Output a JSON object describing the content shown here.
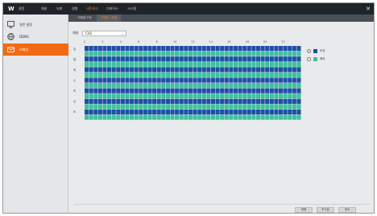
{
  "app": {
    "logo_text": "W",
    "close_glyph": "✕"
  },
  "top_menu": {
    "items": [
      "설정",
      "채널",
      "녹화",
      "경험",
      "네트워크",
      "디바이스",
      "시스템"
    ],
    "active_index": 4
  },
  "sidebar": {
    "items": [
      {
        "label": "일반 설정",
        "icon": "monitor-icon"
      },
      {
        "label": "DDNS",
        "icon": "globe-icon"
      },
      {
        "label": "이메일",
        "icon": "email-icon"
      }
    ],
    "active_index": 2
  },
  "tabs": {
    "items": [
      "이메일 구성",
      "이메일 스케줄"
    ],
    "active_index": 1
  },
  "channel": {
    "label": "채널",
    "value": "CH1",
    "chevron": "⌄"
  },
  "schedule": {
    "hours": [
      "0",
      "2",
      "4",
      "6",
      "8",
      "10",
      "12",
      "14",
      "16",
      "18",
      "20",
      "22"
    ],
    "days": [
      "일",
      "월",
      "화",
      "수",
      "목",
      "금",
      "토"
    ],
    "rows": [
      "bbbbbbbbbbbbbbbbbbbbbbbbbbbbbbbbbbbbbbbbbbbbbbbb",
      "tttttttttttttttttttttttttttttttttttttttttttttttt",
      "bbbbbbbbbbbbbbbbbbbbbbbbbbbbbbbbbbbbbbbbbbbbbbbb",
      "tttttttttttttttttttttttttttttttttttttttttttttttt",
      "bbbbbbbbbbbbbbbbbbbbbbbbbbbbbbbbbbbbbbbbbbbbbbbb",
      "tttttttttttttttttttttttttttttttttttttttttttttttt",
      "bbbbbbbbbbbbbbbbbbbbbbbbbbbbbbbbbbbbbbbbbbbbbbbb",
      "tttttttttttttttttttttttttttttttttttttttttttttttt",
      "bbbbbbbbbbbbbbbbbbbbbbbbbbbbbbbbbbbbbbbbbbbbbbbb",
      "tttttttttttttttttttttttttttttttttttttttttttttttt",
      "bbbbbbbbbbbbbbbbbbbbbbbbbbbbbbbbbbbbbbbbbbbbbbbb",
      "tttttttttttttttttttttttttttttttttttttttttttttttt",
      "bbbbbbbbbbbbbbbbbbbbbbbbbbbbbbbbbbbbbbbbbbbbbbbb",
      "tttttttttttttttttttttttttttttttttttttttttttttttt"
    ],
    "legend": [
      {
        "label": "모션",
        "color": "#1f4ea8",
        "selected": true
      },
      {
        "label": "예외",
        "color": "#3fc19e",
        "selected": false
      }
    ]
  },
  "buttons": {
    "apply": "적용",
    "default": "초기값",
    "cancel": "취소"
  },
  "colors": {
    "accent": "#f26a13",
    "motion": "#1f4ea8",
    "exception": "#3fc19e",
    "topbar": "#1f2429"
  }
}
